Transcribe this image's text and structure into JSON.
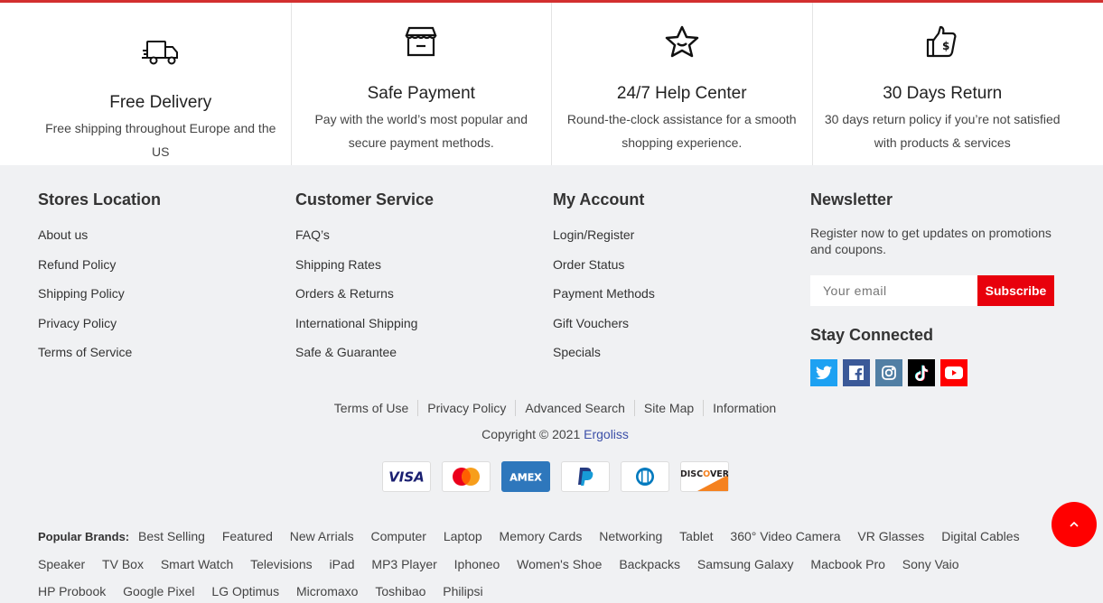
{
  "features": [
    {
      "icon": "truck-icon",
      "title": "Free Delivery",
      "desc": "Free shipping throughout Europe and the US"
    },
    {
      "icon": "store-icon",
      "title": "Safe Payment",
      "desc": "Pay with the world’s most popular and secure payment methods."
    },
    {
      "icon": "star-icon",
      "title": "24/7 Help Center",
      "desc": "Round-the-clock assistance for a smooth shopping experience."
    },
    {
      "icon": "thumbs-up-dollar-icon",
      "title": "30 Days Return",
      "desc": "30 days return policy if you’re not satisfied with products & services"
    }
  ],
  "columns": [
    {
      "title": "Stores Location",
      "items": [
        "About us",
        "Refund Policy",
        "Shipping Policy",
        "Privacy Policy",
        "Terms of Service"
      ]
    },
    {
      "title": "Customer Service",
      "items": [
        "FAQ’s",
        "Shipping Rates",
        "Orders & Returns",
        "International Shipping",
        "Safe & Guarantee"
      ]
    },
    {
      "title": "My Account",
      "items": [
        "Login/Register",
        "Order Status",
        "Payment Methods",
        "Gift Vouchers",
        "Specials"
      ]
    }
  ],
  "newsletter": {
    "title": "Newsletter",
    "text": "Register now to get updates on promotions and coupons.",
    "placeholder": "Your email",
    "button": "Subscribe",
    "stay_title": "Stay Connected",
    "socials": [
      {
        "name": "twitter",
        "color": "#1da1f2"
      },
      {
        "name": "facebook",
        "color": "#3b5998"
      },
      {
        "name": "instagram",
        "color": "#517fa4"
      },
      {
        "name": "tiktok",
        "color": "#000000"
      },
      {
        "name": "youtube",
        "color": "#ff0000"
      }
    ]
  },
  "bottom_links": [
    "Terms of Use",
    "Privacy Policy",
    "Advanced Search",
    "Site Map",
    "Information"
  ],
  "copyright": {
    "prefix": "Copyright © 2021 ",
    "brand": "Ergoliss"
  },
  "payments": [
    "VISA",
    "MasterCard",
    "AMEX",
    "PayPal",
    "Diners",
    "DISCOVER"
  ],
  "popular_brands": {
    "label": "Popular Brands:",
    "items": [
      "Best Selling",
      "Featured",
      "New Arrials",
      "Computer",
      "Laptop",
      "Memory Cards",
      "Networking",
      "Tablet",
      "360° Video Camera",
      "VR Glasses",
      "Digital Cables",
      "Speaker",
      "TV Box",
      "Smart Watch",
      "Televisions",
      "iPad",
      "MP3 Player",
      "Iphoneo",
      "Women's Shoe",
      "Backpacks",
      "Samsung Galaxy",
      "Macbook Pro",
      "Sony Vaio",
      "HP Probook",
      "Google Pixel",
      "LG Optimus",
      "Micromaxo",
      "Toshibao",
      "Philipsi"
    ]
  },
  "colors": {
    "accent": "#e8000c",
    "footer_bg": "#f0f1f3",
    "link_brand": "#3b4fa8"
  }
}
